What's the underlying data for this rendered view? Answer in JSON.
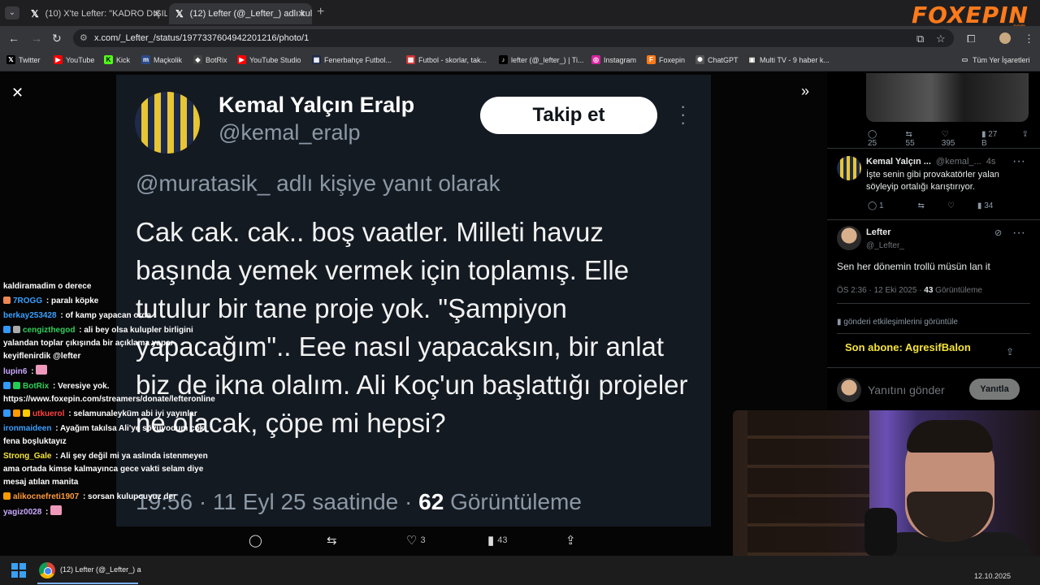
{
  "browser": {
    "tabs": [
      {
        "label": "(10) X'te Lefter: \"KADRO DIŞILA",
        "active": false
      },
      {
        "label": "(12) Lefter (@_Lefter_) adlı kulla",
        "active": true
      }
    ],
    "url": "x.com/_Lefter_/status/1977337604942201216/photo/1",
    "bookmarks": [
      "Twitter",
      "YouTube",
      "Kick",
      "Maçkolik",
      "BotRix",
      "YouTube Studio",
      "Fenerbahçe Futbol...",
      "Futbol - skorlar, tak...",
      "lefter (@_lefter_) | Ti...",
      "Instagram",
      "Foxepin",
      "ChatGPT",
      "Multi TV - 9 haber k..."
    ],
    "all_bookmarks": "Tüm Yer İşaretleri"
  },
  "brand": {
    "name": "FOXEPIN",
    "sub": ".com",
    "color": "#ff7a1a"
  },
  "tweet_image": {
    "name": "Kemal Yalçın Eralp",
    "handle": "@kemal_eralp",
    "follow_label": "Takip et",
    "reply_to": "@muratasik_ adlı kişiye yanıt olarak",
    "text": "Cak cak. cak.. boş vaatler. Milleti havuz başında yemek vermek için toplamış. Elle tutulur bir tane proje yok. \"Şampiyon yapacağım\".. Eee nasıl yapacaksın, bir anlat biz de ikna olalım. Ali Koç'un başlattığı projeler ne olacak, çöpe mi hepsi?",
    "meta_time": "19:56 · 11 Eyl 25 saatinde · ",
    "meta_views_num": "62",
    "meta_views_label": " Görüntüleme"
  },
  "viewer_actions": {
    "likes": "3",
    "views": "43"
  },
  "chat": [
    {
      "user": "",
      "msg": "kaldiramadim o derece",
      "color": "#ffffff"
    },
    {
      "user": "7ROGG",
      "msg": " : paralı köpke",
      "color": "#3aa0ff"
    },
    {
      "user": "berkay253428",
      "msg": " : of kamp yapacan orda",
      "color": "#3aa0ff"
    },
    {
      "user": "cengizthegod",
      "msg": " : ali bey olsa kulupler birligini yalandan toplar çıkışında bir açıklama yapar keyiflenirdik @lefter",
      "color": "#2fd05a"
    },
    {
      "user": "lupin6",
      "msg": " :",
      "color": "#c9a8ff"
    },
    {
      "user": "BotRix",
      "msg": " : Veresiye yok. https://www.foxepin.com/streamers/donate/lefteronline",
      "color": "#2fd05a"
    },
    {
      "user": "utkuerol",
      "msg": " : selamunaleyküm abi iyi yayınlar",
      "color": "#ff4040"
    },
    {
      "user": "ironmaideen",
      "msg": " : Ayağım takılsa Ali'ye sövüyodum çok fena boşluktayız",
      "color": "#3aa0ff"
    },
    {
      "user": "Strong_Gale",
      "msg": " : Ali şey değil mi ya aslında istenmeyen ama ortada kimse kalmayınca gece vakti selam diye mesaj atılan manita",
      "color": "#f5e43a"
    },
    {
      "user": "alikocnefreti1907",
      "msg": " : sorsan kulupcuyuz der",
      "color": "#ff9a3a"
    },
    {
      "user": "yagiz0028",
      "msg": " :",
      "color": "#c9a8ff"
    }
  ],
  "sidebar": {
    "top_stats": {
      "replies": "25",
      "reposts": "55",
      "likes": "395",
      "views": "27 B"
    },
    "reply1": {
      "name": "Kemal Yalçın ...",
      "handle": "@kemal_...",
      "time": "4s",
      "text": "İşte senin gibi provakatörler yalan söyleyip ortalığı karıştırıyor.",
      "replies": "1",
      "views": "34"
    },
    "main": {
      "name": "Lefter",
      "handle": "@_Lefter_",
      "text": "Sen her dönemin trollü müsün lan it",
      "time": "ÖS 2:36 · 12 Eki 2025 · ",
      "views": "43",
      "views_label": " Görüntüleme",
      "engagements": "gönderi etkileşimlerini görüntüle"
    },
    "subscriber_note": "Son abone: AgresifBalon",
    "reply_placeholder": "Yanıtını gönder",
    "reply_button": "Yanıtla"
  },
  "taskbar": {
    "app_label": "(12) Lefter (@_Lefter_) a",
    "clock": "12.10.2025"
  }
}
